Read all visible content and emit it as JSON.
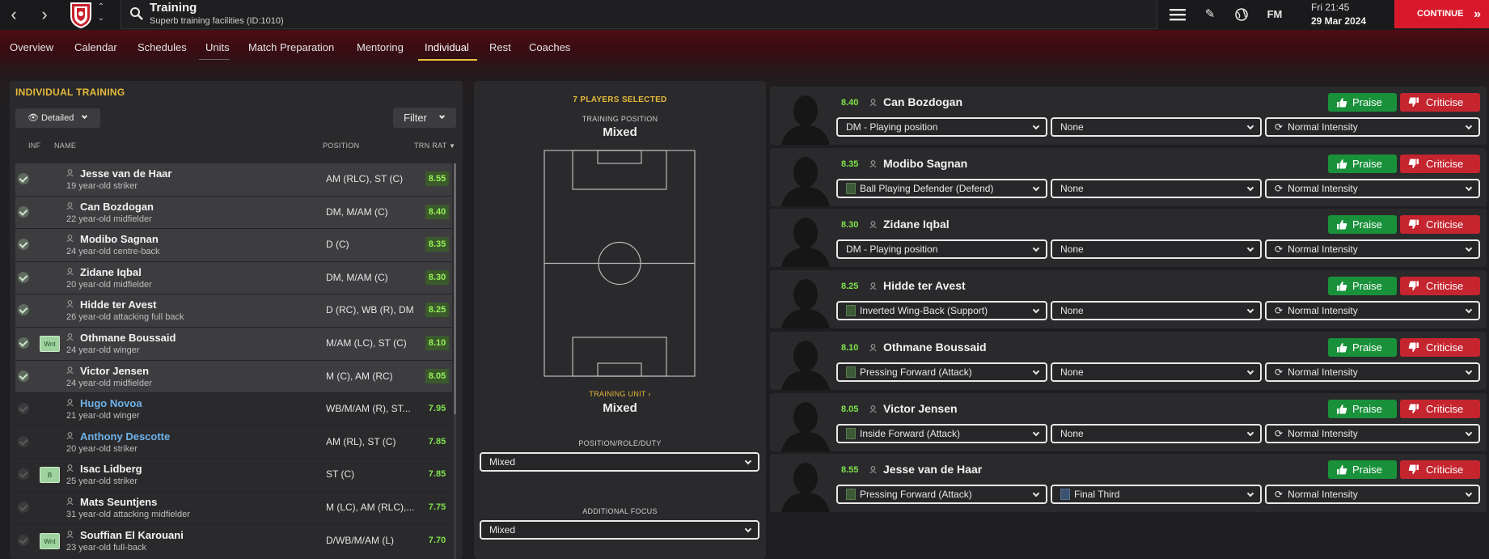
{
  "header": {
    "title": "Training",
    "subtitle": "Superb training facilities (ID:1010)",
    "date_line1": "Fri 21:45",
    "date_line2": "29 Mar 2024",
    "fm_label": "FM",
    "continue_label": "CONTINUE"
  },
  "tabs": [
    "Overview",
    "Calendar",
    "Schedules",
    "Units",
    "Match Preparation",
    "Mentoring",
    "Individual",
    "Rest",
    "Coaches"
  ],
  "left": {
    "title": "INDIVIDUAL TRAINING",
    "view_label": "Detailed",
    "filter_label": "Filter",
    "columns": [
      "INF",
      "NAME",
      "POSITION",
      "TRN RAT"
    ],
    "players": [
      {
        "name": "Jesse van de Haar",
        "desc": "19 year-old striker",
        "pos": "AM (RLC), ST (C)",
        "rat": "8.55",
        "selected": true,
        "badge": ""
      },
      {
        "name": "Can Bozdogan",
        "desc": "22 year-old midfielder",
        "pos": "DM, M/AM (C)",
        "rat": "8.40",
        "selected": true,
        "badge": ""
      },
      {
        "name": "Modibo Sagnan",
        "desc": "24 year-old centre-back",
        "pos": "D (C)",
        "rat": "8.35",
        "selected": true,
        "badge": ""
      },
      {
        "name": "Zidane Iqbal",
        "desc": "20 year-old midfielder",
        "pos": "DM, M/AM (C)",
        "rat": "8.30",
        "selected": true,
        "badge": ""
      },
      {
        "name": "Hidde ter Avest",
        "desc": "26 year-old attacking full back",
        "pos": "D (RC), WB (R), DM",
        "rat": "8.25",
        "selected": true,
        "badge": ""
      },
      {
        "name": "Othmane Boussaid",
        "desc": "24 year-old winger",
        "pos": "M/AM (LC), ST (C)",
        "rat": "8.10",
        "selected": true,
        "badge": "Wnt"
      },
      {
        "name": "Victor Jensen",
        "desc": "24 year-old midfielder",
        "pos": "M (C), AM (RC)",
        "rat": "8.05",
        "selected": true,
        "badge": ""
      },
      {
        "name": "Hugo Novoa",
        "desc": "21 year-old winger",
        "pos": "WB/M/AM (R), ST...",
        "rat": "7.95",
        "selected": false,
        "badge": "",
        "link": true
      },
      {
        "name": "Anthony Descotte",
        "desc": "20 year-old striker",
        "pos": "AM (RL), ST (C)",
        "rat": "7.85",
        "selected": false,
        "badge": "",
        "link": true
      },
      {
        "name": "Isac Lidberg",
        "desc": "25 year-old striker",
        "pos": "ST (C)",
        "rat": "7.85",
        "selected": false,
        "badge": "B"
      },
      {
        "name": "Mats Seuntjens",
        "desc": "31 year-old attacking midfielder",
        "pos": "M (LC), AM (RLC),...",
        "rat": "7.75",
        "selected": false,
        "badge": ""
      },
      {
        "name": "Souffian El Karouani",
        "desc": "23 year-old full-back",
        "pos": "D/WB/M/AM (L)",
        "rat": "7.70",
        "selected": false,
        "badge": "Wnt"
      }
    ]
  },
  "middle": {
    "selected_count": "7 PLAYERS SELECTED",
    "training_position_label": "TRAINING POSITION",
    "training_position_value": "Mixed",
    "training_unit_label": "TRAINING UNIT",
    "training_unit_value": "Mixed",
    "prd_label": "POSITION/ROLE/DUTY",
    "prd_value": "Mixed",
    "focus_label": "ADDITIONAL FOCUS",
    "focus_value": "Mixed"
  },
  "right": {
    "praise_label": "Praise",
    "criticise_label": "Criticise",
    "cards": [
      {
        "rat": "8.40",
        "name": "Can Bozdogan",
        "role": "DM - Playing position",
        "role_swatch": false,
        "focus": "None",
        "focus_swatch": false,
        "intensity": "Normal Intensity"
      },
      {
        "rat": "8.35",
        "name": "Modibo Sagnan",
        "role": "Ball Playing Defender (Defend)",
        "role_swatch": true,
        "focus": "None",
        "focus_swatch": false,
        "intensity": "Normal Intensity"
      },
      {
        "rat": "8.30",
        "name": "Zidane Iqbal",
        "role": "DM - Playing position",
        "role_swatch": false,
        "focus": "None",
        "focus_swatch": false,
        "intensity": "Normal Intensity"
      },
      {
        "rat": "8.25",
        "name": "Hidde ter Avest",
        "role": "Inverted Wing-Back (Support)",
        "role_swatch": true,
        "focus": "None",
        "focus_swatch": false,
        "intensity": "Normal Intensity"
      },
      {
        "rat": "8.10",
        "name": "Othmane Boussaid",
        "role": "Pressing Forward (Attack)",
        "role_swatch": true,
        "focus": "None",
        "focus_swatch": false,
        "intensity": "Normal Intensity"
      },
      {
        "rat": "8.05",
        "name": "Victor Jensen",
        "role": "Inside Forward (Attack)",
        "role_swatch": true,
        "focus": "None",
        "focus_swatch": false,
        "intensity": "Normal Intensity"
      },
      {
        "rat": "8.55",
        "name": "Jesse van de Haar",
        "role": "Pressing Forward (Attack)",
        "role_swatch": true,
        "focus": "Final Third",
        "focus_swatch": true,
        "intensity": "Normal Intensity"
      }
    ]
  },
  "colors": {
    "accent": "#e6b93b",
    "continue": "#d8192c",
    "praise": "#19913a",
    "criticise": "#c4252f",
    "rating": "#7fe34a"
  },
  "icons": [
    "back-icon",
    "forward-icon",
    "club-badge",
    "search-icon",
    "menu-icon",
    "edit-icon",
    "globe-icon",
    "eye-icon",
    "person-icon",
    "thumbs-up-icon",
    "thumbs-down-icon",
    "cycle-icon",
    "chevron-down-icon"
  ]
}
